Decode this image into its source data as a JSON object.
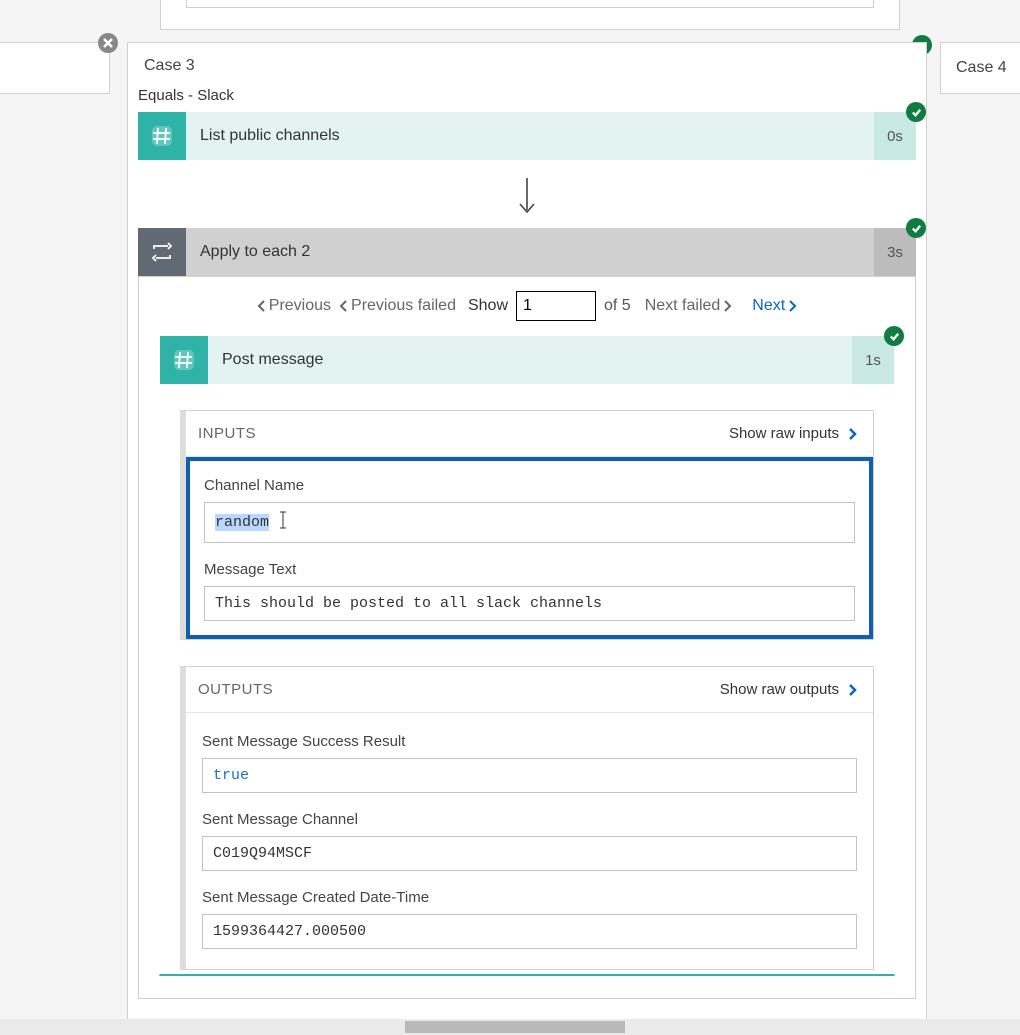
{
  "caseMain": {
    "title": "Case 3",
    "subtitle": "Equals - Slack"
  },
  "caseRight": {
    "title": "Case 4"
  },
  "listChannels": {
    "title": "List public channels",
    "duration": "0s"
  },
  "applyEach": {
    "title": "Apply to each 2",
    "duration": "3s"
  },
  "pager": {
    "previous": "Previous",
    "previousFailed": "Previous failed",
    "showLabel": "Show",
    "inputValue": "1",
    "ofText": "of 5",
    "nextFailed": "Next failed",
    "next": "Next"
  },
  "postMessage": {
    "title": "Post message",
    "duration": "1s"
  },
  "inputsPanel": {
    "title": "INPUTS",
    "rawLink": "Show raw inputs",
    "channelNameLabel": "Channel Name",
    "channelNameValue": "random",
    "messageTextLabel": "Message Text",
    "messageTextValue": "This should be posted to all slack channels"
  },
  "outputsPanel": {
    "title": "OUTPUTS",
    "rawLink": "Show raw outputs",
    "fields": [
      {
        "label": "Sent Message Success Result",
        "value": "true",
        "blue": true
      },
      {
        "label": "Sent Message Channel",
        "value": "C019Q94MSCF",
        "blue": false
      },
      {
        "label": "Sent Message Created Date-Time",
        "value": "1599364427.000500",
        "blue": false
      }
    ]
  }
}
